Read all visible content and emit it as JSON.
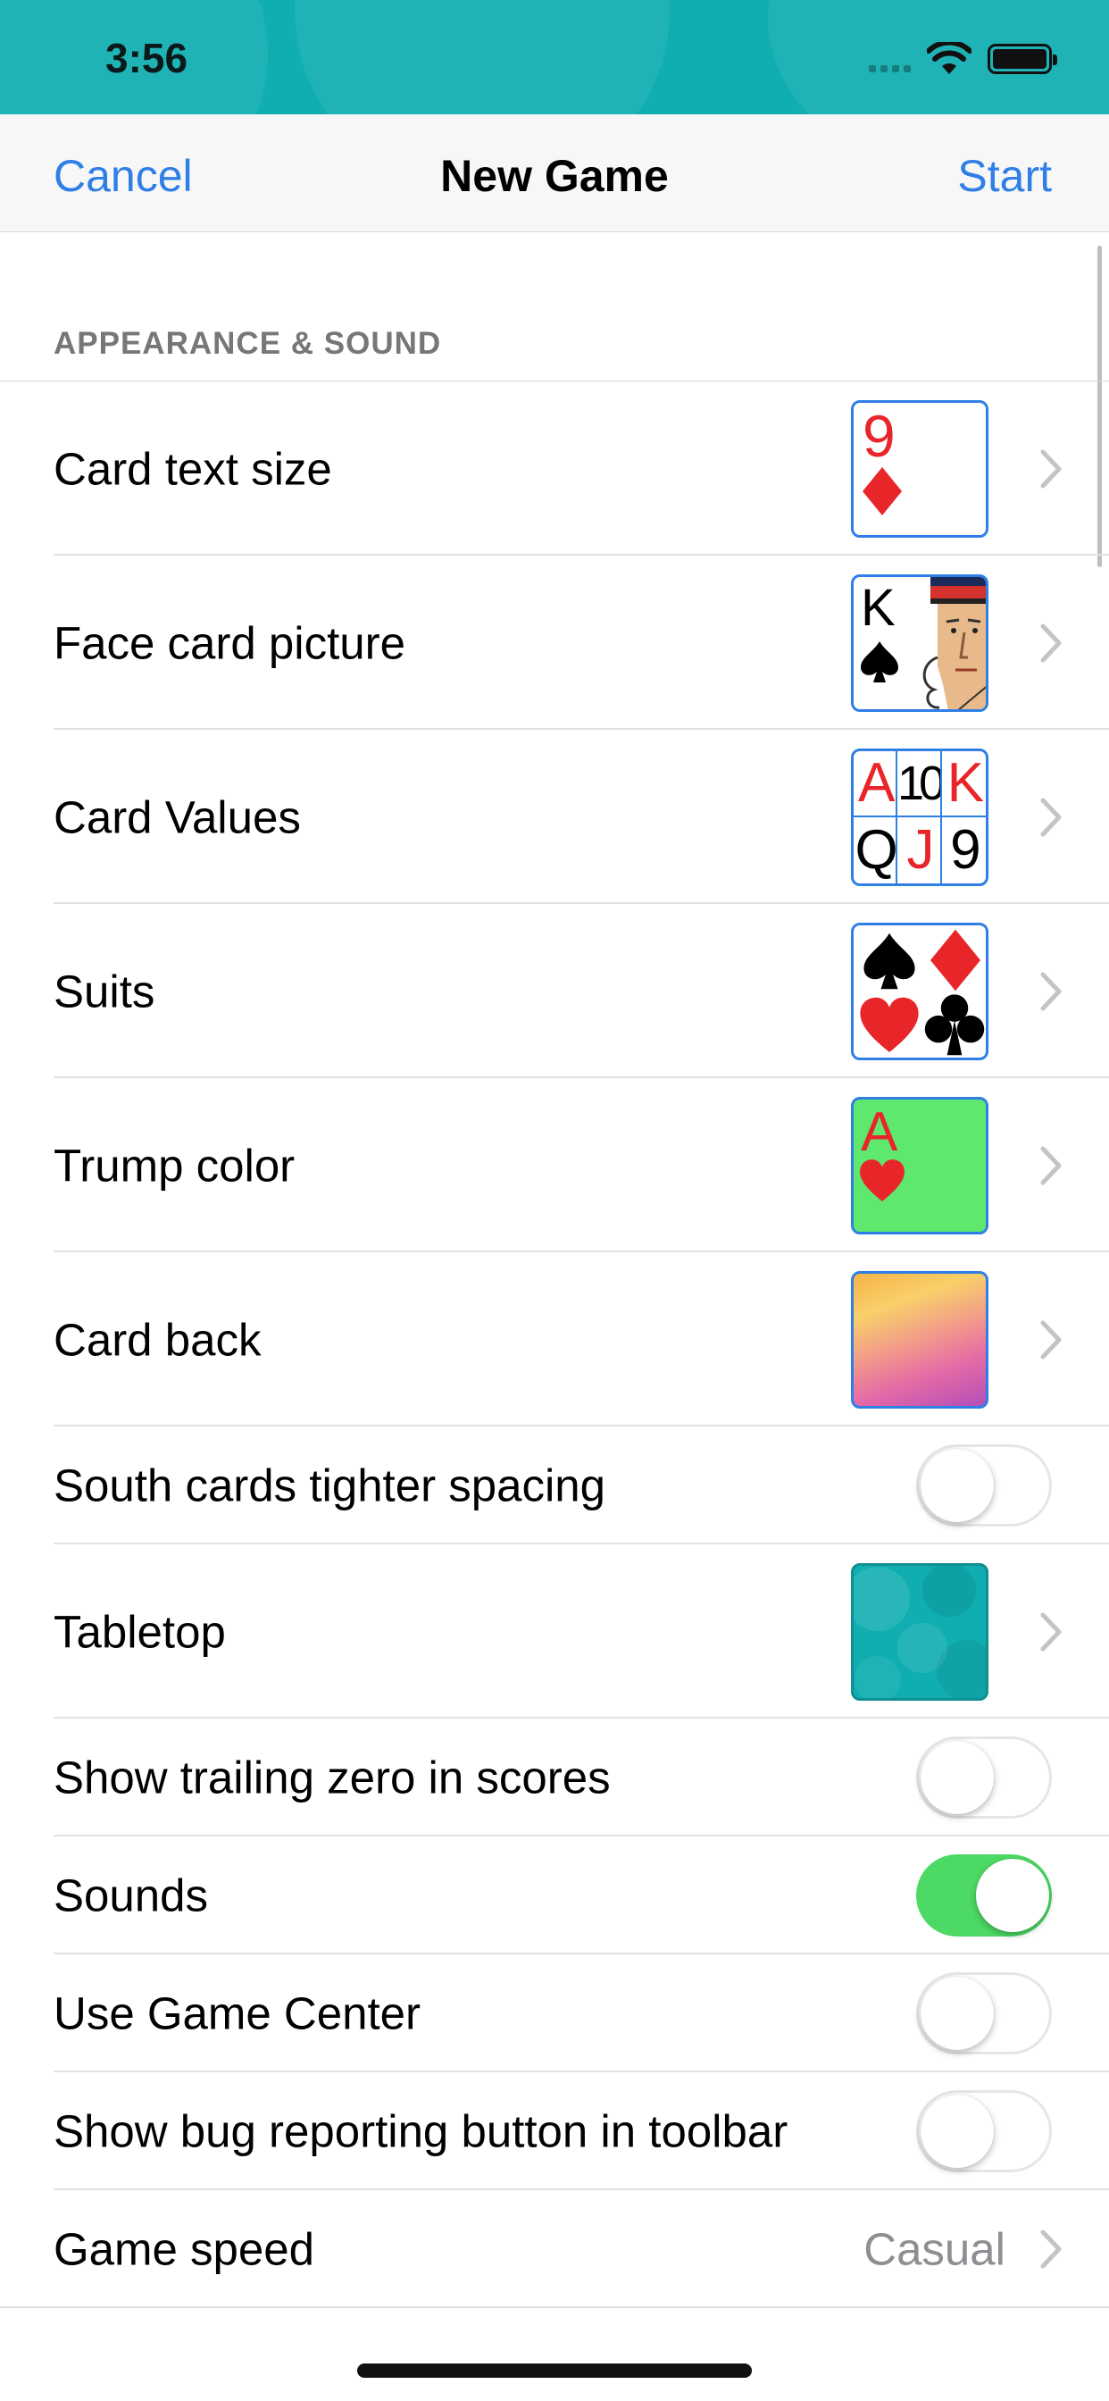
{
  "status_bar": {
    "time": "3:56"
  },
  "nav": {
    "cancel": "Cancel",
    "title": "New Game",
    "start": "Start"
  },
  "section": {
    "header": "APPEARANCE & SOUND"
  },
  "rows": [
    {
      "label": "Card text size",
      "accessory": "chevron",
      "thumbnail": {
        "rank": "9",
        "suit": "diamond"
      }
    },
    {
      "label": "Face card picture",
      "accessory": "chevron",
      "thumbnail": {
        "rank": "K",
        "suit": "spade"
      }
    },
    {
      "label": "Card Values",
      "accessory": "chevron",
      "thumbnail": {
        "cells": [
          "A",
          "10",
          "K",
          "Q",
          "J",
          "9"
        ]
      }
    },
    {
      "label": "Suits",
      "accessory": "chevron",
      "thumbnail": {
        "suits": [
          "spade",
          "diamond",
          "heart",
          "club"
        ]
      }
    },
    {
      "label": "Trump color",
      "accessory": "chevron",
      "thumbnail": {
        "rank": "A",
        "suit": "heart",
        "background": "#5ee86e"
      }
    },
    {
      "label": "Card back",
      "accessory": "chevron",
      "thumbnail": {
        "style": "pastel-gradient"
      }
    },
    {
      "label": "South cards tighter spacing",
      "accessory": "toggle",
      "on": false
    },
    {
      "label": "Tabletop",
      "accessory": "chevron",
      "thumbnail": {
        "style": "teal-bubbles",
        "background": "#10aeb0"
      }
    },
    {
      "label": "Show trailing zero in scores",
      "accessory": "toggle",
      "on": false
    },
    {
      "label": "Sounds",
      "accessory": "toggle",
      "on": true
    },
    {
      "label": "Use Game Center",
      "accessory": "toggle",
      "on": false
    },
    {
      "label": "Show bug reporting button in toolbar",
      "accessory": "toggle",
      "on": false
    },
    {
      "label": "Game speed",
      "accessory": "chevron",
      "value": "Casual"
    }
  ],
  "colors": {
    "accent": "#2f7fe6",
    "toggle_on": "#4cd964",
    "status_bar": "#10aeb0",
    "suit_red": "#e8262a"
  },
  "icons": {
    "chevron": "chevron-right-icon",
    "wifi": "wifi-icon",
    "battery": "battery-icon",
    "signal": "signal-icon"
  }
}
